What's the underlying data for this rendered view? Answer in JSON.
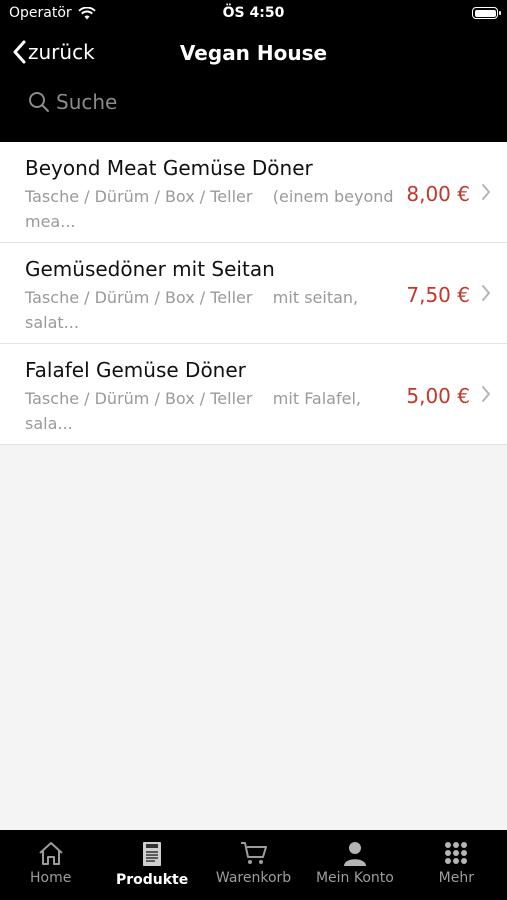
{
  "status": {
    "carrier": "Operatör",
    "time": "ÖS 4:50"
  },
  "nav": {
    "back_label": "zurück",
    "title": "Vegan House"
  },
  "search": {
    "placeholder": "Suche"
  },
  "items": [
    {
      "title": "Beyond Meat Gemüse Döner",
      "desc_line1": "Tasche / Dürüm / Box / Teller    (einem beyond",
      "desc_line2": "mea...",
      "price": "8,00 €"
    },
    {
      "title": "Gemüsedöner mit Seitan",
      "desc_line1": "Tasche / Dürüm / Box / Teller    mit seitan,",
      "desc_line2": "salat...",
      "price": "7,50 €"
    },
    {
      "title": "Falafel Gemüse Döner",
      "desc_line1": "Tasche / Dürüm / Box / Teller    mit Falafel,",
      "desc_line2": "sala...",
      "price": "5,00 €"
    }
  ],
  "tabs": [
    {
      "label": "Home",
      "icon": "home-icon"
    },
    {
      "label": "Produkte",
      "icon": "menu-card-icon",
      "active": true
    },
    {
      "label": "Warenkorb",
      "icon": "cart-icon"
    },
    {
      "label": "Mein Konto",
      "icon": "user-icon"
    },
    {
      "label": "Mehr",
      "icon": "grid-icon"
    }
  ],
  "colors": {
    "header_bg": "#000000",
    "price": "#c0392b",
    "tab_active": "#ffffff",
    "tab_inactive": "#9c9c9c"
  }
}
